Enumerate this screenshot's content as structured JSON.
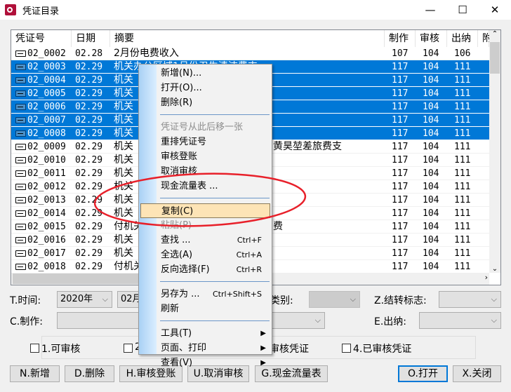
{
  "window": {
    "title": "凭证目录",
    "icon": "app-logo-icon",
    "minimize": "—",
    "maximize": "☐",
    "close": "✕"
  },
  "table": {
    "columns": [
      "凭证号",
      "日期",
      "摘要",
      "制作",
      "审核",
      "出纳",
      "附"
    ],
    "rows": [
      {
        "no": "02_0002",
        "date": "02.28",
        "summary": "2月份电费收入",
        "tail": "",
        "maker": "107",
        "auditor": "104",
        "cashier": "106",
        "selected": false
      },
      {
        "no": "02_0003",
        "date": "02.29",
        "summary": "机关办公区域1月份卫生清洁费支",
        "tail": "",
        "maker": "117",
        "auditor": "104",
        "cashier": "111",
        "selected": true
      },
      {
        "no": "02_0004",
        "date": "02.29",
        "summary": "机关",
        "tail": "",
        "maker": "117",
        "auditor": "104",
        "cashier": "111",
        "selected": true
      },
      {
        "no": "02_0005",
        "date": "02.29",
        "summary": "机关",
        "tail": "",
        "maker": "117",
        "auditor": "104",
        "cashier": "111",
        "selected": true
      },
      {
        "no": "02_0006",
        "date": "02.29",
        "summary": "机关",
        "tail": "",
        "maker": "117",
        "auditor": "104",
        "cashier": "111",
        "selected": true
      },
      {
        "no": "02_0007",
        "date": "02.29",
        "summary": "机关",
        "tail": "",
        "maker": "117",
        "auditor": "104",
        "cashier": "111",
        "selected": true
      },
      {
        "no": "02_0008",
        "date": "02.29",
        "summary": "机关",
        "tail": "",
        "maker": "117",
        "auditor": "104",
        "cashier": "111",
        "selected": true
      },
      {
        "no": "02_0009",
        "date": "02.29",
        "summary": "机关",
        "tail": "黄昊堃差旅费支",
        "maker": "117",
        "auditor": "104",
        "cashier": "111",
        "selected": false
      },
      {
        "no": "02_0010",
        "date": "02.29",
        "summary": "机关",
        "tail": "",
        "maker": "117",
        "auditor": "104",
        "cashier": "111",
        "selected": false
      },
      {
        "no": "02_0011",
        "date": "02.29",
        "summary": "机关",
        "tail": "",
        "maker": "117",
        "auditor": "104",
        "cashier": "111",
        "selected": false
      },
      {
        "no": "02_0012",
        "date": "02.29",
        "summary": "机关",
        "tail": "",
        "maker": "117",
        "auditor": "104",
        "cashier": "111",
        "selected": false
      },
      {
        "no": "02_0013",
        "date": "02.29",
        "summary": "机关",
        "tail": "",
        "maker": "117",
        "auditor": "104",
        "cashier": "111",
        "selected": false
      },
      {
        "no": "02_0014",
        "date": "02.29",
        "summary": "机关",
        "tail": "",
        "maker": "117",
        "auditor": "104",
        "cashier": "111",
        "selected": false
      },
      {
        "no": "02_0015",
        "date": "02.29",
        "summary": "付机关",
        "tail": "费",
        "maker": "117",
        "auditor": "104",
        "cashier": "111",
        "selected": false
      },
      {
        "no": "02_0016",
        "date": "02.29",
        "summary": "机关",
        "tail": "",
        "maker": "117",
        "auditor": "104",
        "cashier": "111",
        "selected": false
      },
      {
        "no": "02_0017",
        "date": "02.29",
        "summary": "机关",
        "tail": "",
        "maker": "117",
        "auditor": "104",
        "cashier": "111",
        "selected": false
      },
      {
        "no": "02_0018",
        "date": "02.29",
        "summary": "付机关",
        "tail": "",
        "maker": "117",
        "auditor": "104",
        "cashier": "111",
        "selected": false
      }
    ]
  },
  "context_menu": {
    "items": [
      {
        "label": "新增(N)...",
        "shortcut": "",
        "disabled": false
      },
      {
        "label": "打开(O)...",
        "shortcut": "",
        "disabled": false
      },
      {
        "label": "删除(R)",
        "shortcut": "",
        "disabled": false
      },
      {
        "separator": true
      },
      {
        "label": "凭证号从此后移一张",
        "shortcut": "",
        "disabled": true
      },
      {
        "label": "重排凭证号",
        "shortcut": "",
        "disabled": false
      },
      {
        "label": "审核登账",
        "shortcut": "",
        "disabled": false
      },
      {
        "label": "取消审核",
        "shortcut": "",
        "disabled": false
      },
      {
        "label": "现金流量表 ...",
        "shortcut": "",
        "disabled": false
      },
      {
        "separator": true
      },
      {
        "label": "复制(C)",
        "shortcut": "",
        "disabled": false,
        "highlighted": true
      },
      {
        "label": "粘贴(P)",
        "shortcut": "",
        "disabled": true
      },
      {
        "label": "查找 ...",
        "shortcut": "Ctrl+F",
        "disabled": false
      },
      {
        "label": "全选(A)",
        "shortcut": "Ctrl+A",
        "disabled": false
      },
      {
        "label": "反向选择(F)",
        "shortcut": "Ctrl+R",
        "disabled": false
      },
      {
        "separator": true
      },
      {
        "label": "另存为 ...",
        "shortcut": "Ctrl+Shift+S",
        "disabled": false
      },
      {
        "label": "刷新",
        "shortcut": "",
        "disabled": false
      },
      {
        "separator": true
      },
      {
        "label": "工具(T)",
        "shortcut": "",
        "submenu": true
      },
      {
        "label": "页面、打印",
        "shortcut": "",
        "submenu": true
      },
      {
        "label": "查看(V)",
        "shortcut": "",
        "submenu": true
      }
    ]
  },
  "filters": {
    "time_label": "T.时间:",
    "year": "2020年",
    "month": "02月",
    "category_label": "类别:",
    "carry_label": "Z.结转标志:",
    "maker_label": "C.制作:",
    "cashier_label": "E.出纳:"
  },
  "checkboxes": [
    "1.可审核",
    "2",
    "审核凭证",
    "4.已审核凭证"
  ],
  "buttons": [
    "N.新增",
    "D.删除",
    "H.审核登账",
    "U.取消审核",
    "G.现金流量表",
    "O.打开",
    "X.关闭"
  ],
  "annotation": {
    "color": "#e8202a"
  },
  "colors": {
    "selection": "#0078d7",
    "menu_highlight": "#fde4b6"
  }
}
